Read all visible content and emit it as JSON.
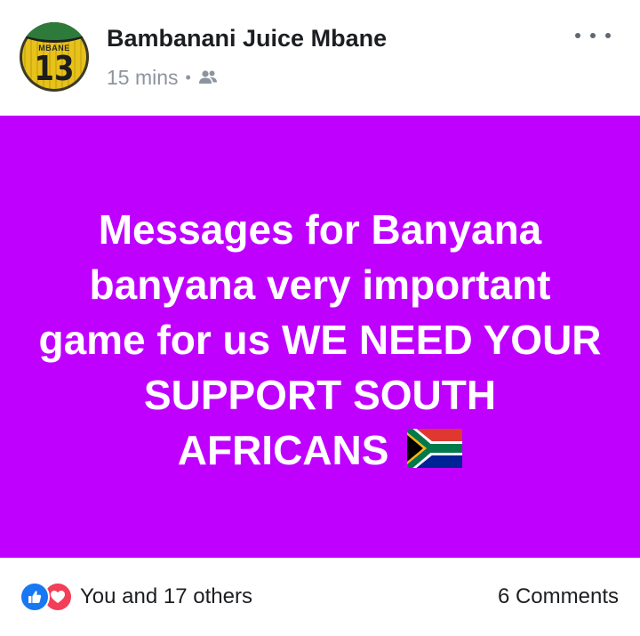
{
  "post": {
    "author": "Bambanani Juice Mbane",
    "time": "15 mins",
    "separator": "•",
    "audience_icon": "friends-icon",
    "avatar": {
      "jersey_name": "MBANE",
      "jersey_number": "13"
    },
    "more_icon": "more-options-icon"
  },
  "banner": {
    "background": "#bf00ff",
    "text": "Messages for Banyana banyana very important game for us WE NEED YOUR SUPPORT SOUTH AFRICANS",
    "emoji_icon": "south-africa-flag-icon"
  },
  "footer": {
    "reactions_text": "You and 17 others",
    "comments_text": "6 Comments",
    "reaction_icons": [
      "like-icon",
      "love-icon"
    ]
  },
  "colors": {
    "like": "#1877f2",
    "love": "#f33e58",
    "meta_gray": "#8d949e"
  }
}
